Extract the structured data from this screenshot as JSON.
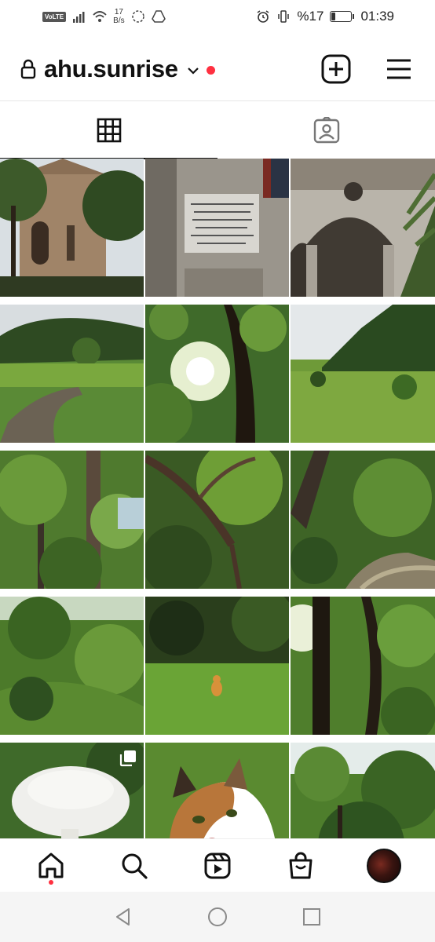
{
  "status_bar": {
    "volte": "VoLTE",
    "net_speed_value": "17",
    "net_speed_unit": "B/s",
    "battery_text": "%17",
    "battery_level": 0.17,
    "time": "01:39"
  },
  "header": {
    "username": "ahu.sunrise",
    "notification_color": "#ff3040"
  },
  "tabs": [
    {
      "icon": "grid-icon",
      "active": true
    },
    {
      "icon": "tagged-icon",
      "active": false
    }
  ],
  "grid": {
    "posts": [
      {
        "subject": "church",
        "multi": false
      },
      {
        "subject": "stone inscription",
        "multi": false
      },
      {
        "subject": "arched ruin",
        "multi": false
      },
      {
        "subject": "meadow path",
        "multi": false
      },
      {
        "subject": "sun through trees",
        "multi": false
      },
      {
        "subject": "green valley",
        "multi": false
      },
      {
        "subject": "forest trunks",
        "multi": false
      },
      {
        "subject": "branches",
        "multi": false
      },
      {
        "subject": "forest stream",
        "multi": false
      },
      {
        "subject": "green slope",
        "multi": false
      },
      {
        "subject": "cat in field",
        "multi": false
      },
      {
        "subject": "forest light",
        "multi": false
      },
      {
        "subject": "mushroom",
        "multi": true
      },
      {
        "subject": "calico cat",
        "multi": false
      },
      {
        "subject": "tree canopy",
        "multi": false
      }
    ]
  },
  "bottom_nav": [
    {
      "icon": "home-icon",
      "active": true
    },
    {
      "icon": "search-icon"
    },
    {
      "icon": "reels-icon"
    },
    {
      "icon": "shop-icon"
    },
    {
      "icon": "profile-avatar"
    }
  ],
  "system_nav": [
    "back-icon",
    "home-circle-icon",
    "recents-icon"
  ]
}
